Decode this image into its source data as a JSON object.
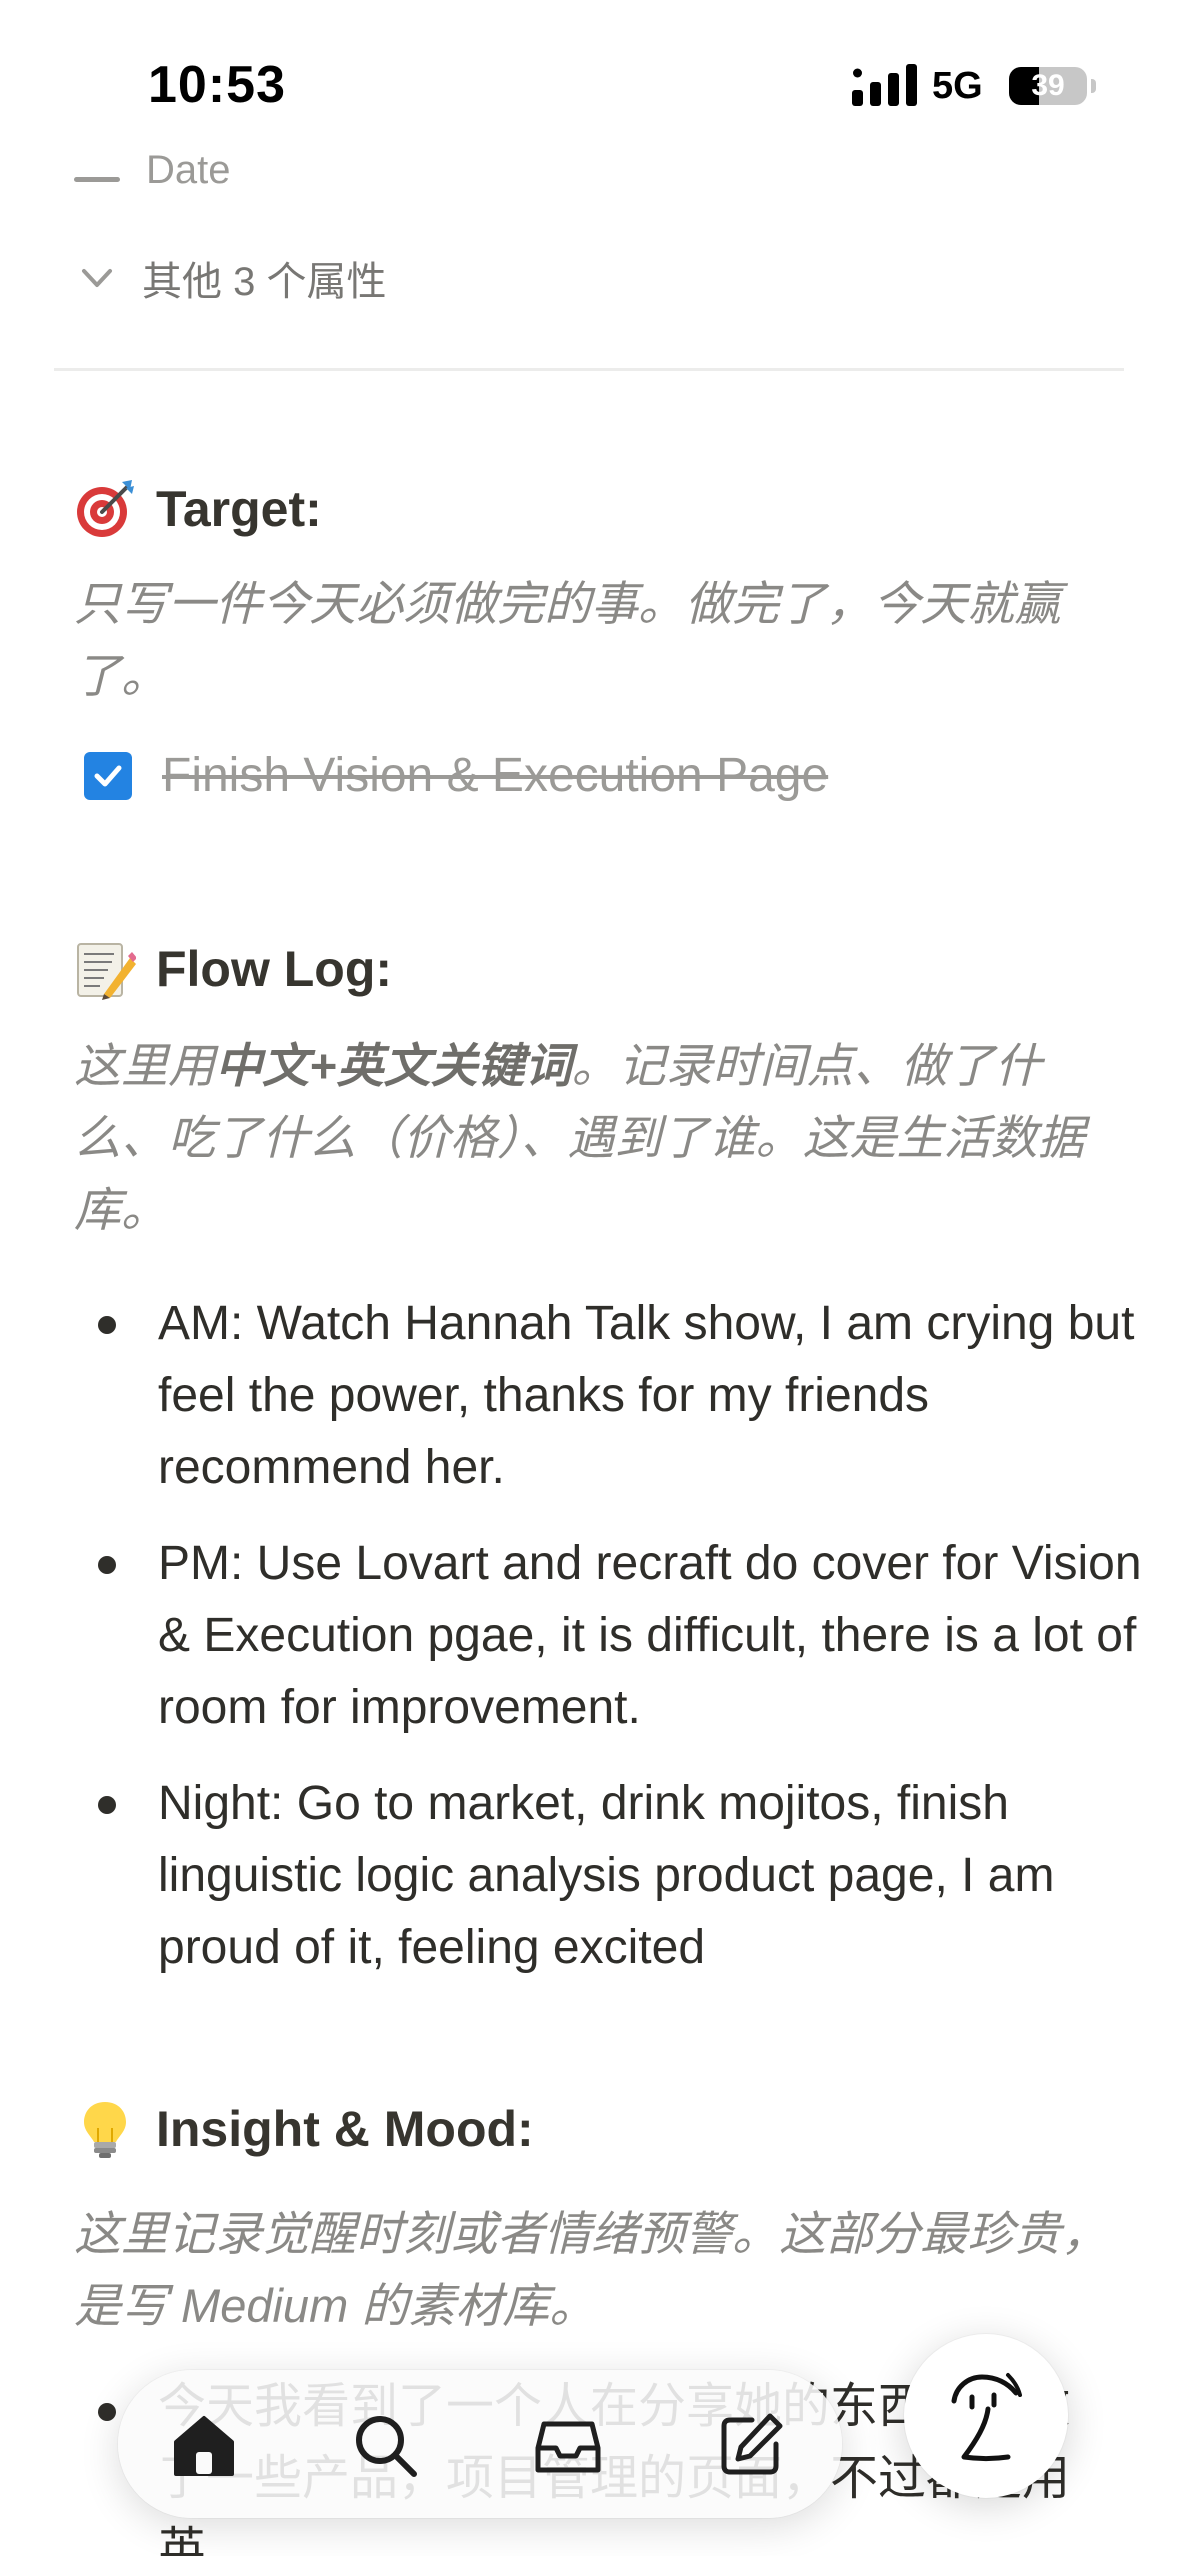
{
  "status_bar": {
    "time": "10:53",
    "network": "5G",
    "battery": "39",
    "battery_level": 0.39
  },
  "properties": {
    "cut_label": "Date",
    "more_label": "其他 3 个属性"
  },
  "target": {
    "emoji": "direct-hit-icon",
    "heading": "Target:",
    "hint": "只写一件今天必须做完的事。做完了，今天就赢了。",
    "todo": {
      "text": "Finish Vision & Execution Page",
      "checked": true
    }
  },
  "flow_log": {
    "emoji": "memo-icon",
    "heading": "Flow Log:",
    "hint_prefix": "这里用",
    "hint_bold": "中文+英文关键词",
    "hint_suffix": "。记录时间点、做了什么、吃了什么（价格）、遇到了谁。这是生活数据库。",
    "items": [
      "AM: Watch Hannah Talk show, I am crying but feel the power, thanks for my friends recommend her.",
      "PM: Use Lovart and recraft do cover for Vision & Execution pgae, it is difficult, there is a lot of room for improvement.",
      "Night: Go to market, drink mojitos, finish linguistic logic analysis product page, I am proud of it, feeling excited"
    ]
  },
  "insight": {
    "emoji": "light-bulb-icon",
    "heading": "Insight & Mood:",
    "hint": "这里记录觉醒时刻或者情绪预警。这部分最珍贵，是写 Medium 的素材库。",
    "partial_item": "今天我看到了一个人在分享她的东西，她做了一些产品，项目管理的页面，不过都是用英"
  },
  "tab_bar": {
    "items": [
      "home-icon",
      "search-icon",
      "inbox-icon",
      "new-page-icon"
    ],
    "active": "home-icon",
    "ai_button": "notion-ai-icon"
  },
  "colors": {
    "text": "#37352f",
    "muted": "#8a8986",
    "checkbox": "#2383e2",
    "divider": "#ececeb"
  }
}
